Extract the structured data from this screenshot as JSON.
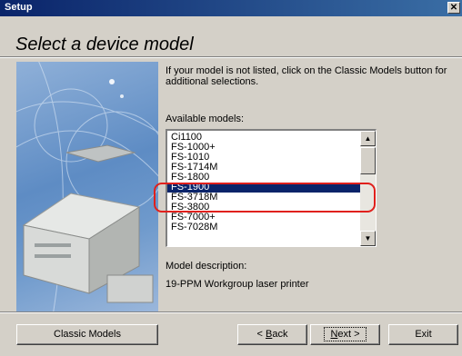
{
  "window": {
    "title": "Setup",
    "close_glyph": "✕"
  },
  "header": {
    "heading": "Select a device model"
  },
  "instructions": "If your model is not listed, click on the Classic Models button for additional selections.",
  "models": {
    "label": "Available models:",
    "items": [
      "Ci1100",
      "FS-1000+",
      "FS-1010",
      "FS-1714M",
      "FS-1800",
      "FS-1900",
      "FS-3718M",
      "FS-3800",
      "FS-7000+",
      "FS-7028M"
    ],
    "selected": "FS-1900"
  },
  "description": {
    "label": "Model description:",
    "value": "19-PPM Workgroup laser printer"
  },
  "buttons": {
    "classic": "Classic Models",
    "back_prefix": "< ",
    "back_key": "B",
    "back_rest": "ack",
    "next_key": "N",
    "next_rest": "ext >",
    "exit": "Exit"
  },
  "scrollbar": {
    "up_glyph": "▲",
    "down_glyph": "▼"
  },
  "colors": {
    "titlebar": "#0a246a",
    "selection": "#0a246a",
    "highlight_ring": "#e0201c",
    "dialog": "#d4d0c8"
  }
}
